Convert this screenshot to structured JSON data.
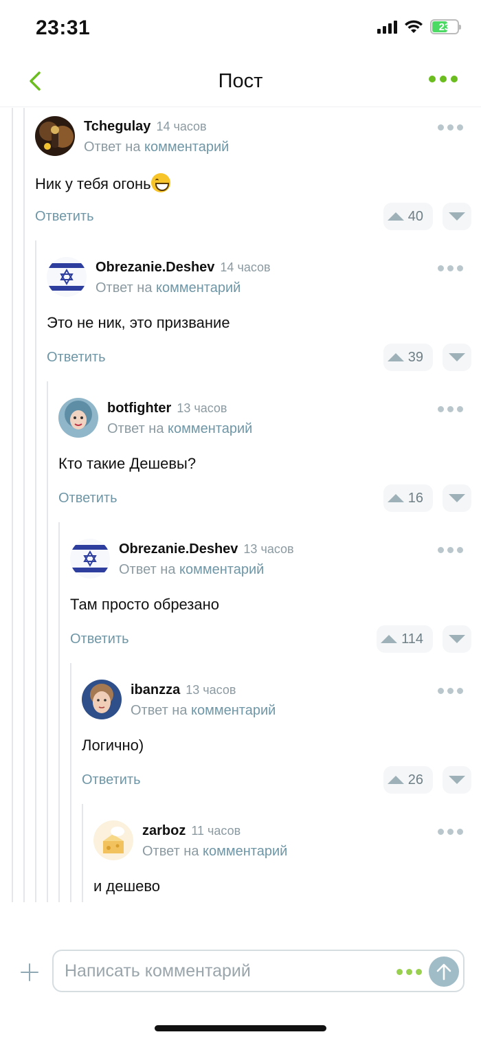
{
  "status_bar": {
    "time": "23:31",
    "battery": "23",
    "icons": [
      "signal-icon",
      "wifi-icon",
      "battery-icon"
    ]
  },
  "header": {
    "back_icon": "chevron-left-icon",
    "title": "Пост",
    "more_icon": "more-dots-icon"
  },
  "colors": {
    "accent_green": "#6bbd1f",
    "link_blue_gray": "#6e96a6",
    "muted_text": "#8b9aa1",
    "thread_line": "#e3e7ea"
  },
  "comments": [
    {
      "author": "Tchegulay",
      "time": "14 часов",
      "reply_prefix": "Ответ на",
      "reply_link": "комментарий",
      "text": "Ник у тебя огонь",
      "emoji": "grinning-face-emoji",
      "reply_label": "Ответить",
      "votes": "40",
      "avatar": "avatar-dark-figure"
    },
    {
      "author": "Obrezanie.Deshev",
      "time": "14 часов",
      "reply_prefix": "Ответ на",
      "reply_link": "комментарий",
      "text": "Это не ник, это призвание",
      "reply_label": "Ответить",
      "votes": "39",
      "avatar": "israel-flag-avatar"
    },
    {
      "author": "botfighter",
      "time": "13 часов",
      "reply_prefix": "Ответ на",
      "reply_link": "комментарий",
      "text": "Кто такие Дешевы?",
      "reply_label": "Ответить",
      "votes": "16",
      "avatar": "avatar-person-photo"
    },
    {
      "author": "Obrezanie.Deshev",
      "time": "13 часов",
      "reply_prefix": "Ответ на",
      "reply_link": "комментарий",
      "text": "Там просто обрезано",
      "reply_label": "Ответить",
      "votes": "114",
      "avatar": "israel-flag-avatar"
    },
    {
      "author": "ibanzza",
      "time": "13 часов",
      "reply_prefix": "Ответ на",
      "reply_link": "комментарий",
      "text": "Логично)",
      "reply_label": "Ответить",
      "votes": "26",
      "avatar": "avatar-person-photo"
    },
    {
      "author": "zarboz",
      "time": "11 часов",
      "reply_prefix": "Ответ на",
      "reply_link": "комментарий",
      "text": "и дешево",
      "avatar": "avatar-cheese-illustration"
    }
  ],
  "composer": {
    "placeholder": "Написать комментарий",
    "add_icon": "plus-icon",
    "more_icon": "more-dots-icon",
    "send_icon": "arrow-up-icon"
  }
}
